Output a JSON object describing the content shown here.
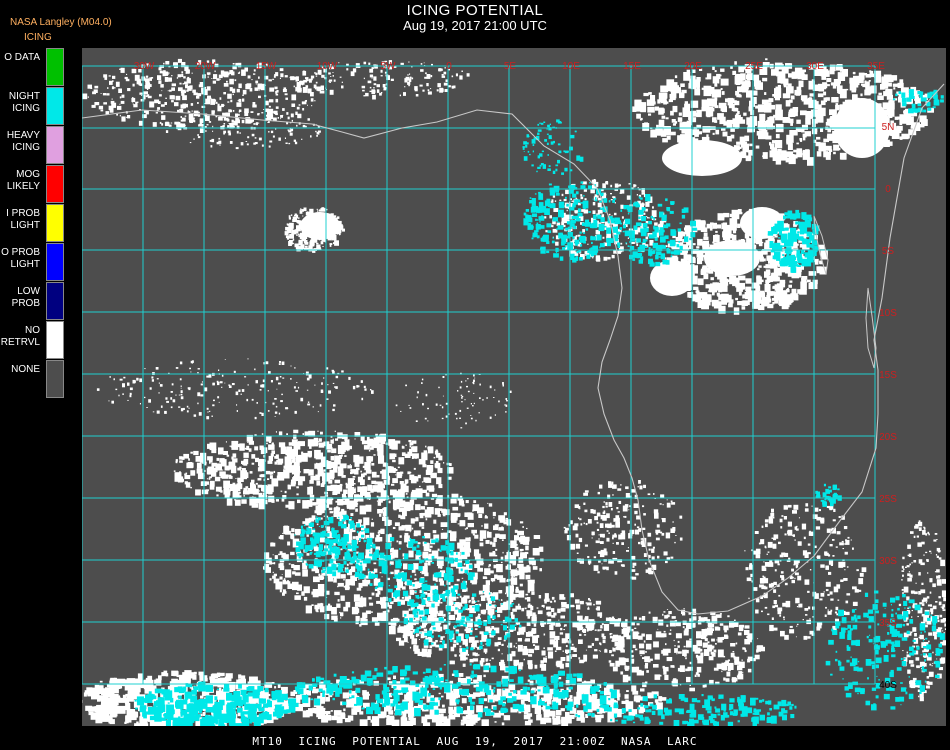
{
  "header": {
    "title": "ICING POTENTIAL",
    "subtitle": "Aug 19, 2017 21:00 UTC",
    "producer": "NASA Langley (M04.0)",
    "product": "ICING"
  },
  "legend": [
    {
      "label": "O DATA",
      "color": "#00c000"
    },
    {
      "label": "NIGHT\nICING",
      "color": "#00e8e8"
    },
    {
      "label": "HEAVY\nICING",
      "color": "#e0a0e0"
    },
    {
      "label": "MOG\nLIKELY",
      "color": "#ff0000"
    },
    {
      "label": "I PROB\nLIGHT",
      "color": "#ffff00"
    },
    {
      "label": "O PROB\nLIGHT",
      "color": "#0000ff"
    },
    {
      "label": "LOW\nPROB",
      "color": "#000080"
    },
    {
      "label": "NO\nRETRVL",
      "color": "#ffffff"
    },
    {
      "label": "NONE",
      "color": "#4d4d4d"
    }
  ],
  "map": {
    "background_color": "#4d4d4d",
    "grid_color": "#20d0d0",
    "label_color": "#cc2020",
    "coast_color": "#c8c8c8",
    "clear_cloud_color": "#ffffff",
    "icing_cloud_color": "#00e8e8",
    "lon_labels": [
      "30W",
      "20W",
      "15W",
      "10W",
      "5W",
      "0",
      "5E",
      "10E",
      "15E",
      "20E",
      "25E",
      "30E",
      "35E"
    ],
    "lat_labels": [
      "5N",
      "0",
      "5S",
      "10S",
      "15S",
      "20S",
      "25S",
      "30S",
      "35S",
      "40S"
    ]
  },
  "footer": {
    "text": "MT10 ICING POTENTIAL AUG 19, 2017 21:00Z NASA LARC"
  }
}
